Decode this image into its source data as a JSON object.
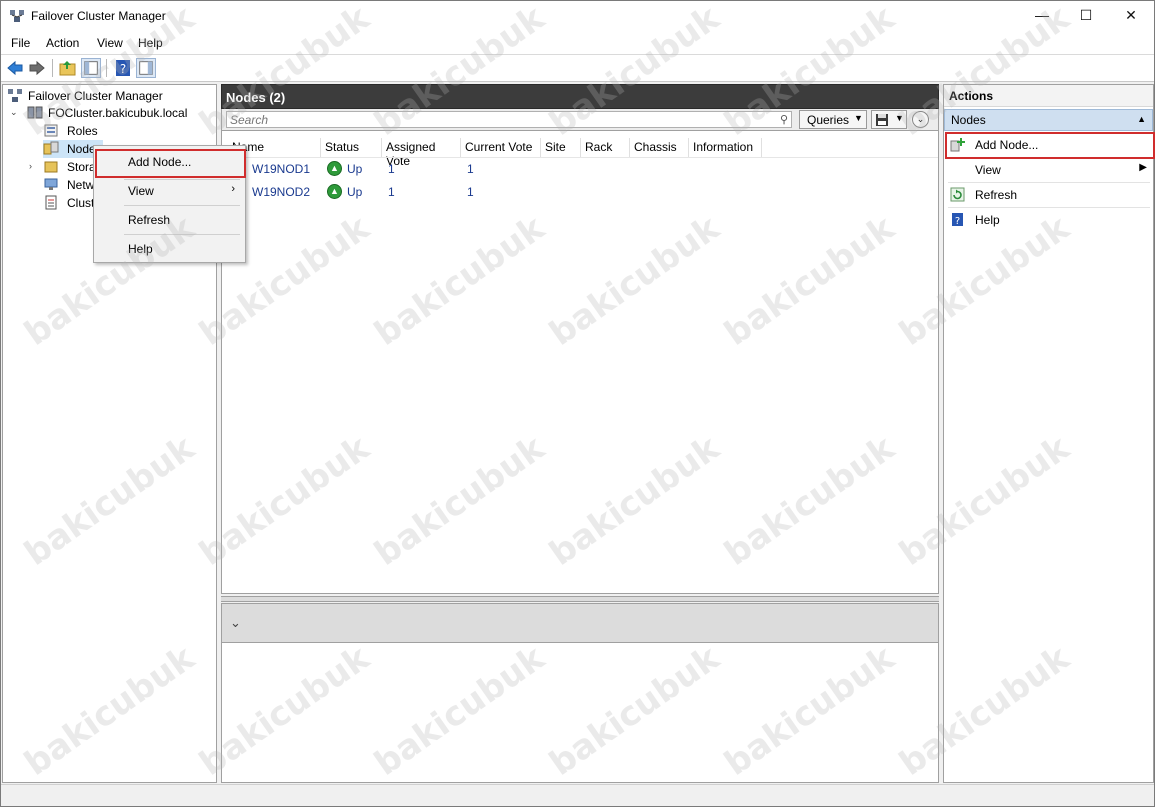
{
  "window": {
    "title": "Failover Cluster Manager",
    "minimize": "—",
    "maximize": "☐",
    "close": "✕"
  },
  "menu": [
    "File",
    "Action",
    "View",
    "Help"
  ],
  "tree": {
    "root": "Failover Cluster Manager",
    "cluster": "FOCluster.bakicubuk.local",
    "items": [
      "Roles",
      "Nodes",
      "Stora",
      "Netw",
      "Clust"
    ]
  },
  "center": {
    "header": "Nodes (2)",
    "search_placeholder": "Search",
    "queries_label": "Queries",
    "columns": [
      "Name",
      "Status",
      "Assigned Vote",
      "Current Vote",
      "Site",
      "Rack",
      "Chassis",
      "Information"
    ],
    "rows": [
      {
        "name": "W19NOD1",
        "status": "Up",
        "assigned_vote": "1",
        "current_vote": "1"
      },
      {
        "name": "W19NOD2",
        "status": "Up",
        "assigned_vote": "1",
        "current_vote": "1"
      }
    ]
  },
  "context_menu": {
    "items": [
      "Add Node...",
      "View",
      "Refresh",
      "Help"
    ]
  },
  "actions": {
    "title": "Actions",
    "section": "Nodes",
    "items": [
      "Add Node...",
      "View",
      "Refresh",
      "Help"
    ]
  },
  "watermark": "bakicubuk",
  "colors": {
    "highlight": "#d02d2d",
    "header_bg": "#3c3c3c",
    "section_bg": "#cfdff0"
  }
}
